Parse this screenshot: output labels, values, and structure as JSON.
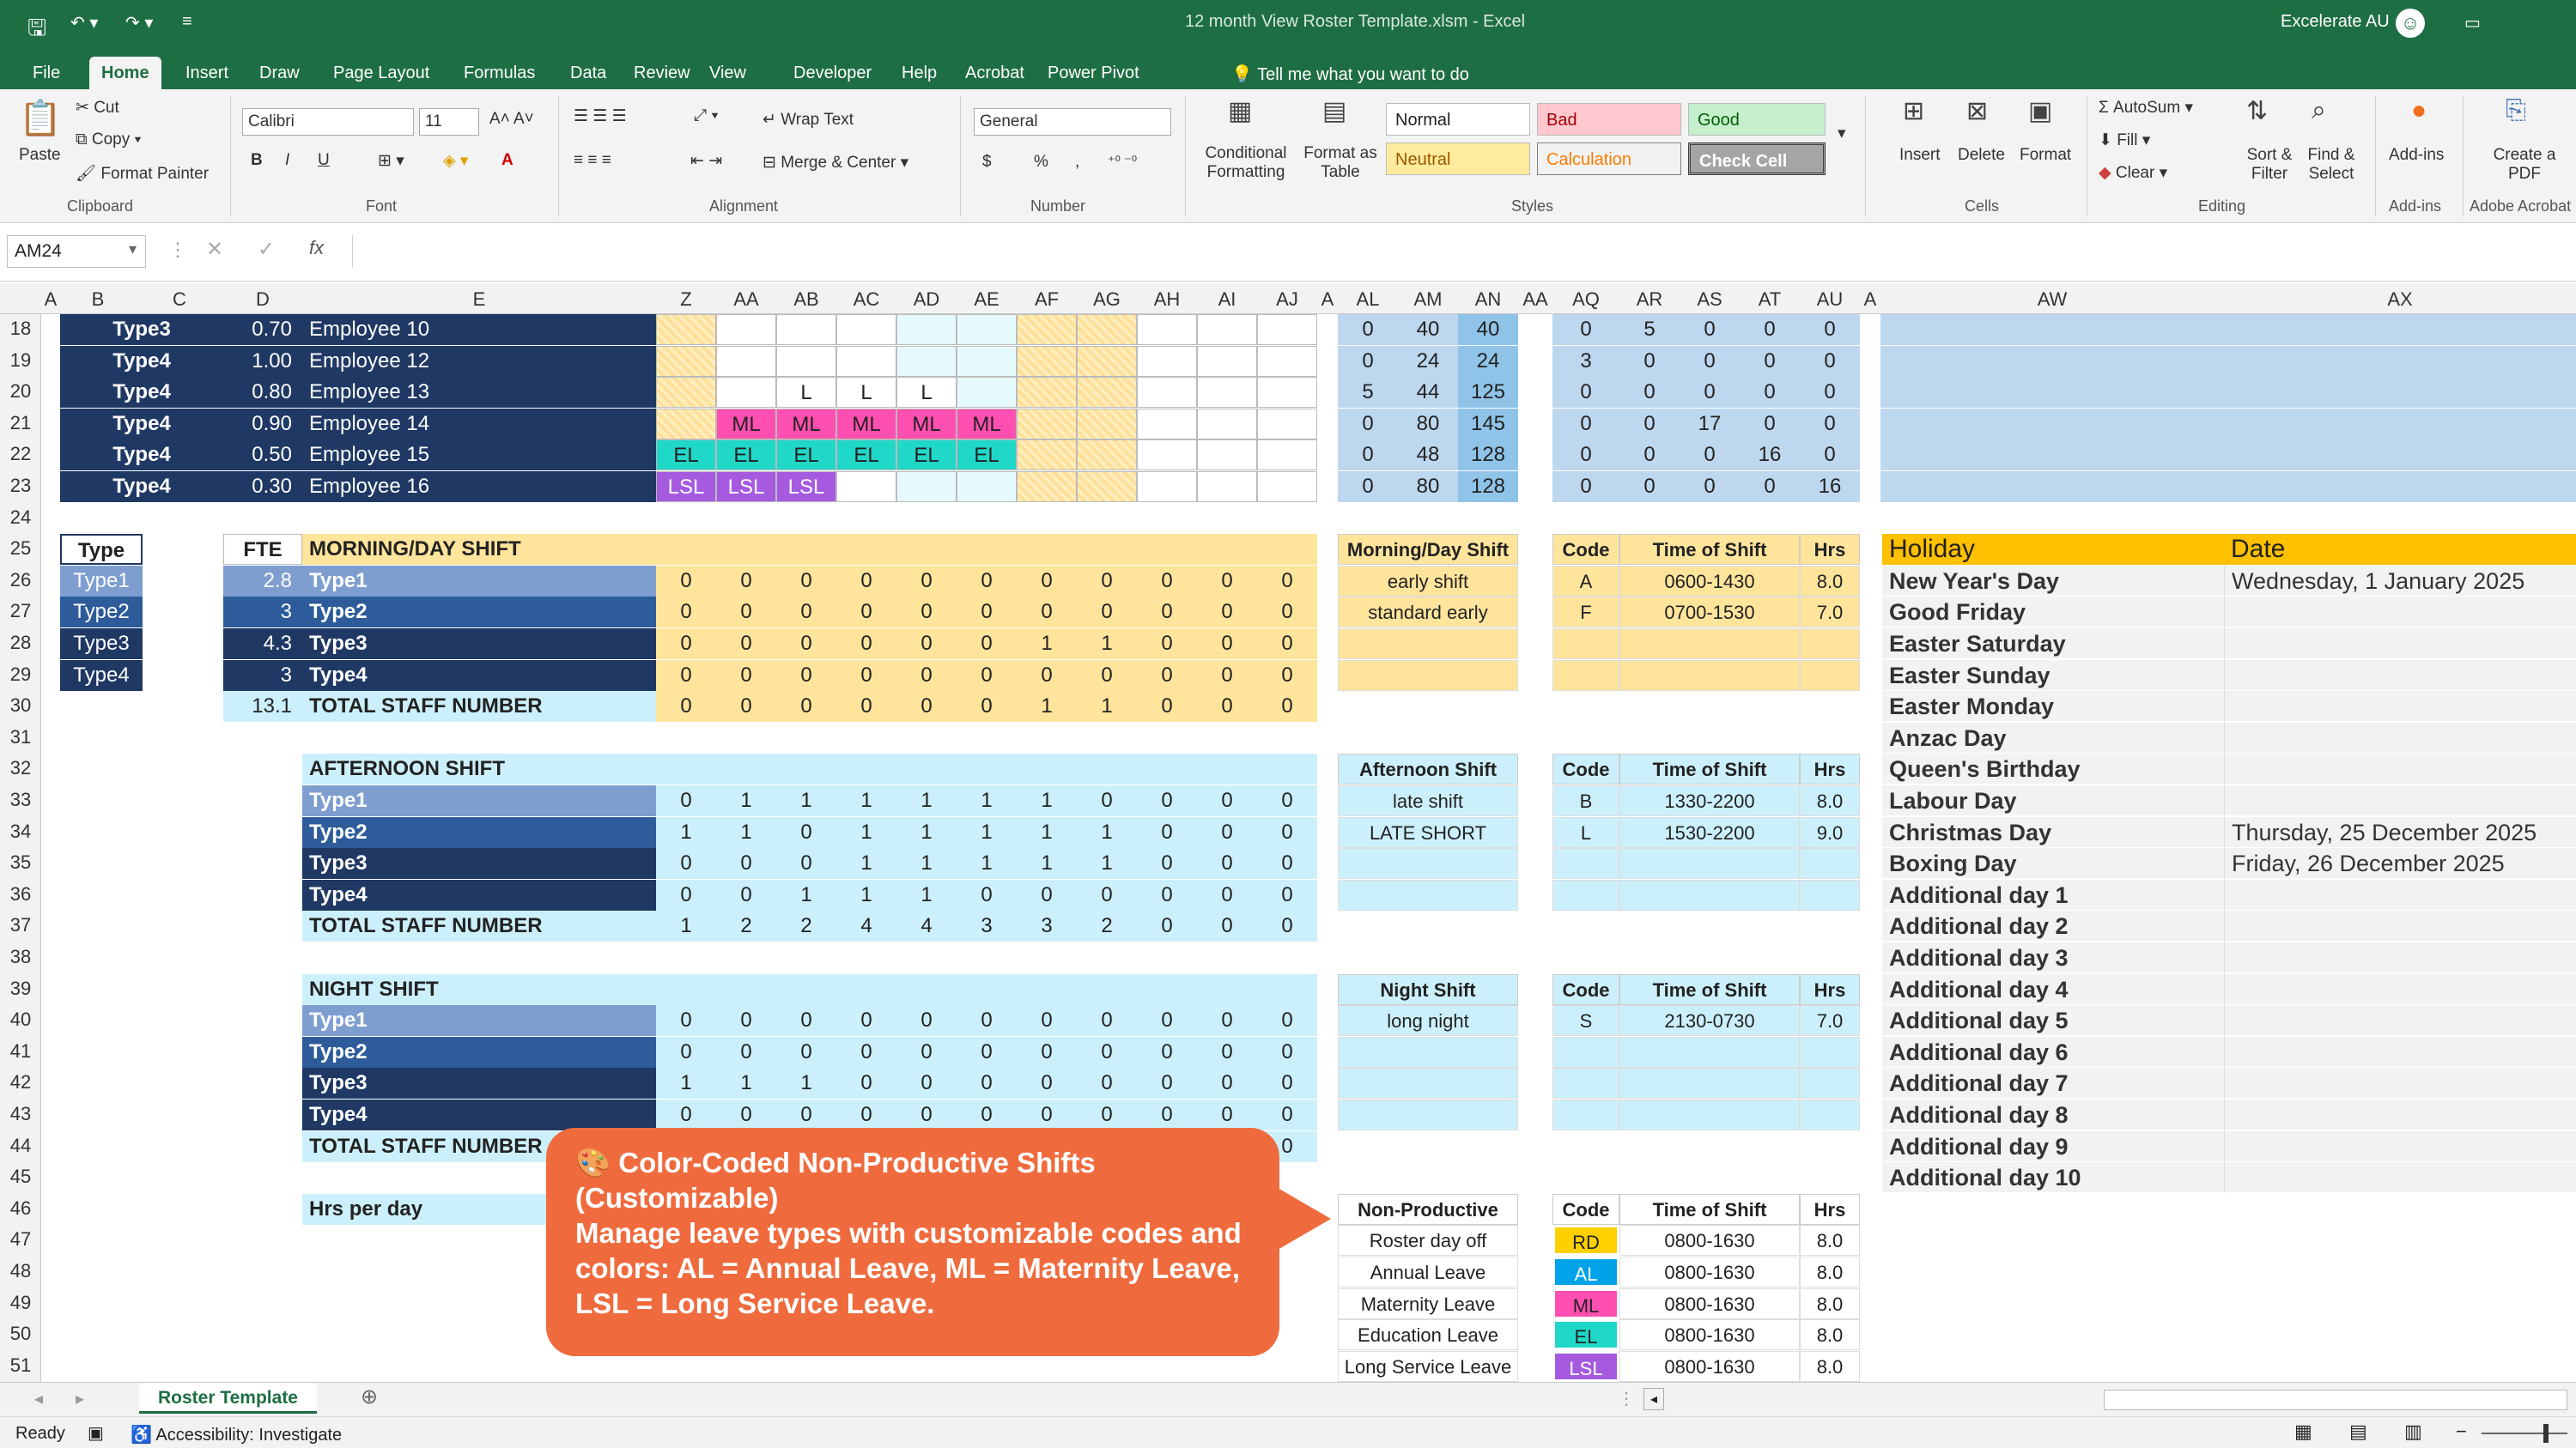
{
  "app": {
    "file_title": "12 month View Roster Template.xlsm  -  Excel",
    "account": "Excelerate AU"
  },
  "tabs": [
    "File",
    "Home",
    "Insert",
    "Draw",
    "Page Layout",
    "Formulas",
    "Data",
    "Review",
    "View",
    "Developer",
    "Help",
    "Acrobat",
    "Power Pivot"
  ],
  "tell_me": "Tell me what you want to do",
  "ribbon": {
    "clipboard": {
      "paste": "Paste",
      "cut": "Cut",
      "copy": "Copy",
      "format_painter": "Format Painter",
      "label": "Clipboard"
    },
    "font": {
      "name": "Calibri",
      "size": "11",
      "label": "Font",
      "bold": "B",
      "italic": "I",
      "underline": "U",
      "font_color": "A"
    },
    "alignment": {
      "wrap": "Wrap Text",
      "merge": "Merge & Center",
      "label": "Alignment"
    },
    "number": {
      "format": "General",
      "label": "Number",
      "currency": "$",
      "percent": "%",
      "comma": ","
    },
    "styles": {
      "cond_fmt": "Conditional Formatting",
      "fmt_table": "Format as Table",
      "normal": "Normal",
      "bad": "Bad",
      "good": "Good",
      "neutral": "Neutral",
      "calculation": "Calculation",
      "check_cell": "Check Cell",
      "label": "Styles"
    },
    "cells": {
      "insert": "Insert",
      "delete": "Delete",
      "format": "Format",
      "label": "Cells"
    },
    "editing": {
      "autosum": "AutoSum",
      "fill": "Fill",
      "clear": "Clear",
      "sort": "Sort & Filter",
      "find": "Find & Select",
      "label": "Editing"
    },
    "addins": {
      "btn": "Add-ins",
      "label": "Add-ins"
    },
    "acrobat": {
      "btn": "Create a PDF",
      "label": "Adobe Acrobat"
    }
  },
  "formula_bar": {
    "name_box": "AM24",
    "fx": "fx",
    "value": ""
  },
  "columns": [
    "A",
    "B",
    "C",
    "D",
    "E",
    "Z",
    "AA",
    "AB",
    "AC",
    "AD",
    "AE",
    "AF",
    "AG",
    "AH",
    "AI",
    "AJ",
    "A",
    "AL",
    "AM",
    "AN",
    "AA",
    "AQ",
    "AR",
    "AS",
    "AT",
    "AU",
    "A",
    "AW",
    "AX"
  ],
  "rows": [
    "18",
    "19",
    "20",
    "21",
    "22",
    "23",
    "24",
    "25",
    "26",
    "27",
    "28",
    "29",
    "30",
    "31",
    "32",
    "33",
    "34",
    "35",
    "36",
    "37",
    "38",
    "39",
    "40",
    "41",
    "42",
    "43",
    "44",
    "45",
    "46",
    "47",
    "48",
    "49",
    "50",
    "51"
  ],
  "employees": [
    {
      "type": "Type3",
      "fte": "0.70",
      "name": "Employee 10",
      "shifts": [
        "",
        "",
        "",
        "",
        "",
        "",
        "",
        "",
        "",
        "",
        ""
      ],
      "al": "0",
      "am": "40",
      "an": "40",
      "aq": "0",
      "ar": "5",
      "as": "0",
      "at": "0",
      "au": "0"
    },
    {
      "type": "Type4",
      "fte": "1.00",
      "name": "Employee 12",
      "shifts": [
        "",
        "",
        "",
        "",
        "",
        "",
        "",
        "",
        "",
        "",
        ""
      ],
      "al": "0",
      "am": "24",
      "an": "24",
      "aq": "3",
      "ar": "0",
      "as": "0",
      "at": "0",
      "au": "0"
    },
    {
      "type": "Type4",
      "fte": "0.80",
      "name": "Employee 13",
      "shifts": [
        "",
        "",
        "L",
        "L",
        "L",
        "",
        "",
        "",
        "",
        "",
        ""
      ],
      "al": "5",
      "am": "44",
      "an": "125",
      "aq": "0",
      "ar": "0",
      "as": "0",
      "at": "0",
      "au": "0"
    },
    {
      "type": "Type4",
      "fte": "0.90",
      "name": "Employee 14",
      "shifts": [
        "",
        "ML",
        "ML",
        "ML",
        "ML",
        "ML",
        "",
        "",
        "",
        "",
        ""
      ],
      "al": "0",
      "am": "80",
      "an": "145",
      "aq": "0",
      "ar": "0",
      "as": "17",
      "at": "0",
      "au": "0"
    },
    {
      "type": "Type4",
      "fte": "0.50",
      "name": "Employee 15",
      "shifts": [
        "EL",
        "EL",
        "EL",
        "EL",
        "EL",
        "EL",
        "",
        "",
        "",
        "",
        ""
      ],
      "al": "0",
      "am": "48",
      "an": "128",
      "aq": "0",
      "ar": "0",
      "as": "0",
      "at": "16",
      "au": "0"
    },
    {
      "type": "Type4",
      "fte": "0.30",
      "name": "Employee 16",
      "shifts": [
        "LSL",
        "LSL",
        "LSL",
        "",
        "",
        "",
        "",
        "",
        "",
        "",
        ""
      ],
      "al": "0",
      "am": "80",
      "an": "128",
      "aq": "0",
      "ar": "0",
      "as": "0",
      "at": "0",
      "au": "16"
    }
  ],
  "type_table": {
    "type_hdr": "Type",
    "fte_hdr": "FTE",
    "rows": [
      {
        "type": "Type1",
        "fte": "2.8"
      },
      {
        "type": "Type2",
        "fte": "3"
      },
      {
        "type": "Type3",
        "fte": "4.3"
      },
      {
        "type": "Type4",
        "fte": "3"
      }
    ],
    "total": "13.1"
  },
  "shift_blocks": [
    {
      "title": "MORNING/DAY SHIFT",
      "rows": [
        {
          "label": "Type1",
          "v": [
            "0",
            "0",
            "0",
            "0",
            "0",
            "0",
            "0",
            "0",
            "0",
            "0",
            "0"
          ]
        },
        {
          "label": "Type2",
          "v": [
            "0",
            "0",
            "0",
            "0",
            "0",
            "0",
            "0",
            "0",
            "0",
            "0",
            "0"
          ]
        },
        {
          "label": "Type3",
          "v": [
            "0",
            "0",
            "0",
            "0",
            "0",
            "0",
            "1",
            "1",
            "0",
            "0",
            "0"
          ]
        },
        {
          "label": "Type4",
          "v": [
            "0",
            "0",
            "0",
            "0",
            "0",
            "0",
            "0",
            "0",
            "0",
            "0",
            "0"
          ]
        }
      ],
      "total_label": "TOTAL STAFF NUMBER",
      "total": [
        "0",
        "0",
        "0",
        "0",
        "0",
        "0",
        "1",
        "1",
        "0",
        "0",
        "0"
      ]
    },
    {
      "title": "AFTERNOON SHIFT",
      "rows": [
        {
          "label": "Type1",
          "v": [
            "0",
            "1",
            "1",
            "1",
            "1",
            "1",
            "1",
            "0",
            "0",
            "0",
            "0"
          ]
        },
        {
          "label": "Type2",
          "v": [
            "1",
            "1",
            "0",
            "1",
            "1",
            "1",
            "1",
            "1",
            "0",
            "0",
            "0"
          ]
        },
        {
          "label": "Type3",
          "v": [
            "0",
            "0",
            "0",
            "1",
            "1",
            "1",
            "1",
            "1",
            "0",
            "0",
            "0"
          ]
        },
        {
          "label": "Type4",
          "v": [
            "0",
            "0",
            "1",
            "1",
            "1",
            "0",
            "0",
            "0",
            "0",
            "0",
            "0"
          ]
        }
      ],
      "total_label": "TOTAL STAFF NUMBER",
      "total": [
        "1",
        "2",
        "2",
        "4",
        "4",
        "3",
        "3",
        "2",
        "0",
        "0",
        "0"
      ]
    },
    {
      "title": "NIGHT SHIFT",
      "rows": [
        {
          "label": "Type1",
          "v": [
            "0",
            "0",
            "0",
            "0",
            "0",
            "0",
            "0",
            "0",
            "0",
            "0",
            "0"
          ]
        },
        {
          "label": "Type2",
          "v": [
            "0",
            "0",
            "0",
            "0",
            "0",
            "0",
            "0",
            "0",
            "0",
            "0",
            "0"
          ]
        },
        {
          "label": "Type3",
          "v": [
            "1",
            "1",
            "1",
            "0",
            "0",
            "0",
            "0",
            "0",
            "0",
            "0",
            "0"
          ]
        },
        {
          "label": "Type4",
          "v": [
            "0",
            "0",
            "0",
            "0",
            "0",
            "0",
            "0",
            "0",
            "0",
            "0",
            "0"
          ]
        }
      ],
      "total_label": "TOTAL STAFF NUMBER",
      "total": [
        "",
        "",
        "",
        "",
        "",
        "",
        "",
        "",
        "",
        "",
        "0"
      ]
    }
  ],
  "hrs_per_day": "Hrs per day",
  "shift_defs": [
    {
      "title": "Morning/Day Shift",
      "items": [
        {
          "name": "early shift",
          "code": "A",
          "time": "0600-1430",
          "hrs": "8.0"
        },
        {
          "name": "standard early",
          "code": "F",
          "time": "0700-1530",
          "hrs": "7.0"
        }
      ]
    },
    {
      "title": "Afternoon Shift",
      "items": [
        {
          "name": "late shift",
          "code": "B",
          "time": "1330-2200",
          "hrs": "8.0"
        },
        {
          "name": "LATE SHORT",
          "code": "L",
          "time": "1530-2200",
          "hrs": "9.0"
        }
      ]
    },
    {
      "title": "Night Shift",
      "items": [
        {
          "name": "long night",
          "code": "S",
          "time": "2130-0730",
          "hrs": "7.0"
        }
      ]
    },
    {
      "title": "Non-Productive",
      "items": [
        {
          "name": "Roster day off",
          "code": "RD",
          "time": "0800-1630",
          "hrs": "8.0",
          "color": "#ffd000"
        },
        {
          "name": "Annual Leave",
          "code": "AL",
          "time": "0800-1630",
          "hrs": "8.0",
          "color": "#00a2e8"
        },
        {
          "name": "Maternity Leave",
          "code": "ML",
          "time": "0800-1630",
          "hrs": "8.0",
          "color": "#ff4fb0"
        },
        {
          "name": "Education Leave",
          "code": "EL",
          "time": "0800-1630",
          "hrs": "8.0",
          "color": "#20d8c8"
        },
        {
          "name": "Long Service Leave",
          "code": "LSL",
          "time": "0800-1630",
          "hrs": "8.0",
          "color": "#a55ae0"
        }
      ]
    }
  ],
  "def_headers": {
    "code": "Code",
    "time": "Time of Shift",
    "hrs": "Hrs"
  },
  "holidays": {
    "hdr_holiday": "Holiday",
    "hdr_date": "Date",
    "items": [
      {
        "name": "New Year's Day",
        "date": "Wednesday, 1 January 2025"
      },
      {
        "name": "Good Friday",
        "date": ""
      },
      {
        "name": "Easter Saturday",
        "date": ""
      },
      {
        "name": "Easter Sunday",
        "date": ""
      },
      {
        "name": "Easter Monday",
        "date": ""
      },
      {
        "name": "Anzac Day",
        "date": ""
      },
      {
        "name": "Queen's Birthday",
        "date": ""
      },
      {
        "name": "Labour Day",
        "date": ""
      },
      {
        "name": "Christmas Day",
        "date": "Thursday, 25 December 2025"
      },
      {
        "name": "Boxing Day",
        "date": "Friday, 26 December 2025"
      },
      {
        "name": "Additional day 1",
        "date": ""
      },
      {
        "name": "Additional day 2",
        "date": ""
      },
      {
        "name": "Additional day 3",
        "date": ""
      },
      {
        "name": "Additional day 4",
        "date": ""
      },
      {
        "name": "Additional day 5",
        "date": ""
      },
      {
        "name": "Additional day 6",
        "date": ""
      },
      {
        "name": "Additional day 7",
        "date": ""
      },
      {
        "name": "Additional day 8",
        "date": ""
      },
      {
        "name": "Additional day 9",
        "date": ""
      },
      {
        "name": "Additional day 10",
        "date": ""
      }
    ]
  },
  "callout": {
    "text": "🎨 Color-Coded Non-Productive Shifts (Customizable)\nManage leave types with customizable codes and colors: AL = Annual Leave, ML = Maternity Leave, LSL = Long Service Leave."
  },
  "sheet_tab": "Roster Template",
  "status": {
    "ready": "Ready",
    "accessibility": "Accessibility: Investigate"
  },
  "colors": {
    "excel_green": "#1e6e43",
    "navy": "#1f3864",
    "callout": "#ef6b3e",
    "ml": "#ff4fb0",
    "el": "#20d8c8",
    "lsl": "#a55ae0"
  }
}
